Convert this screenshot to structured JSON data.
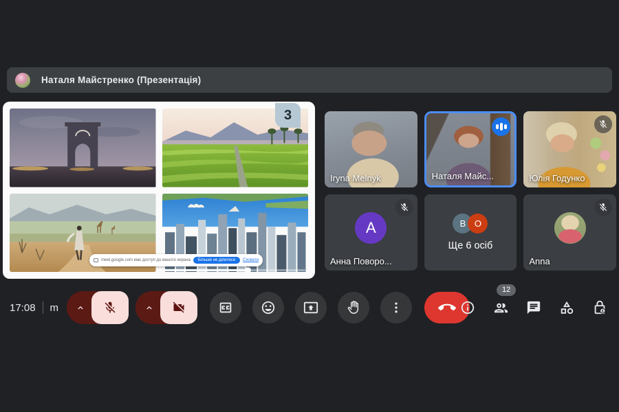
{
  "header": {
    "presenter": "Наталя Майстренко (Презентація)"
  },
  "presentation": {
    "slide_badge": "3",
    "images": [
      "arc-de-triomphe-dusk",
      "rice-terraces-sunset",
      "savanna-walk-giraffes",
      "sydney-harbour-aerial"
    ],
    "share_notification": {
      "message": "meet.google.com має доступ до вашого екрана",
      "stop_sharing": "Більше не ділитися",
      "hide": "Сховати"
    }
  },
  "participants": [
    {
      "name": "Iryna Melnyk",
      "muted": false,
      "speaking": false
    },
    {
      "name": "Наталя Майс...",
      "muted": false,
      "speaking": true
    },
    {
      "name": "Юлія Годунко",
      "muted": true,
      "speaking": false
    },
    {
      "name": "Анна Поворо...",
      "muted": true,
      "speaking": false,
      "initial": "А"
    },
    {
      "name": "Ще 6 осіб",
      "badges": {
        "b": "B",
        "o": "O"
      }
    },
    {
      "name": "Anna",
      "muted": true,
      "speaking": false
    }
  ],
  "toolbar": {
    "time": "17:08",
    "meeting_code": "m",
    "people_count": "12"
  },
  "icons": {
    "left_controls": [
      "chevron-up-icon",
      "mic-off-icon",
      "chevron-up-icon",
      "videocam-off-icon"
    ],
    "center_controls": [
      "captions-icon",
      "emoji-icon",
      "present-icon",
      "raise-hand-icon",
      "more-options-icon",
      "end-call-icon"
    ],
    "right_controls": [
      "info-icon",
      "people-icon",
      "chat-icon",
      "activities-icon",
      "host-controls-lock-icon"
    ],
    "tile_icons": [
      "mic-off-icon",
      "audio-speaking-icon"
    ]
  },
  "colors": {
    "background": "#202124",
    "surface": "#3c4043",
    "accent_blue": "#1a73e8",
    "speaking_border": "#4c8df6",
    "end_call_red": "#dd3730",
    "muted_control_dark": "#5c1a15",
    "muted_control_light": "#f9dedc",
    "avatar_purple": "#6639c4",
    "avatar_bluegray": "#5c7482",
    "avatar_orange": "#cc3d12",
    "slide_badge_bg": "#b6c8d3"
  }
}
